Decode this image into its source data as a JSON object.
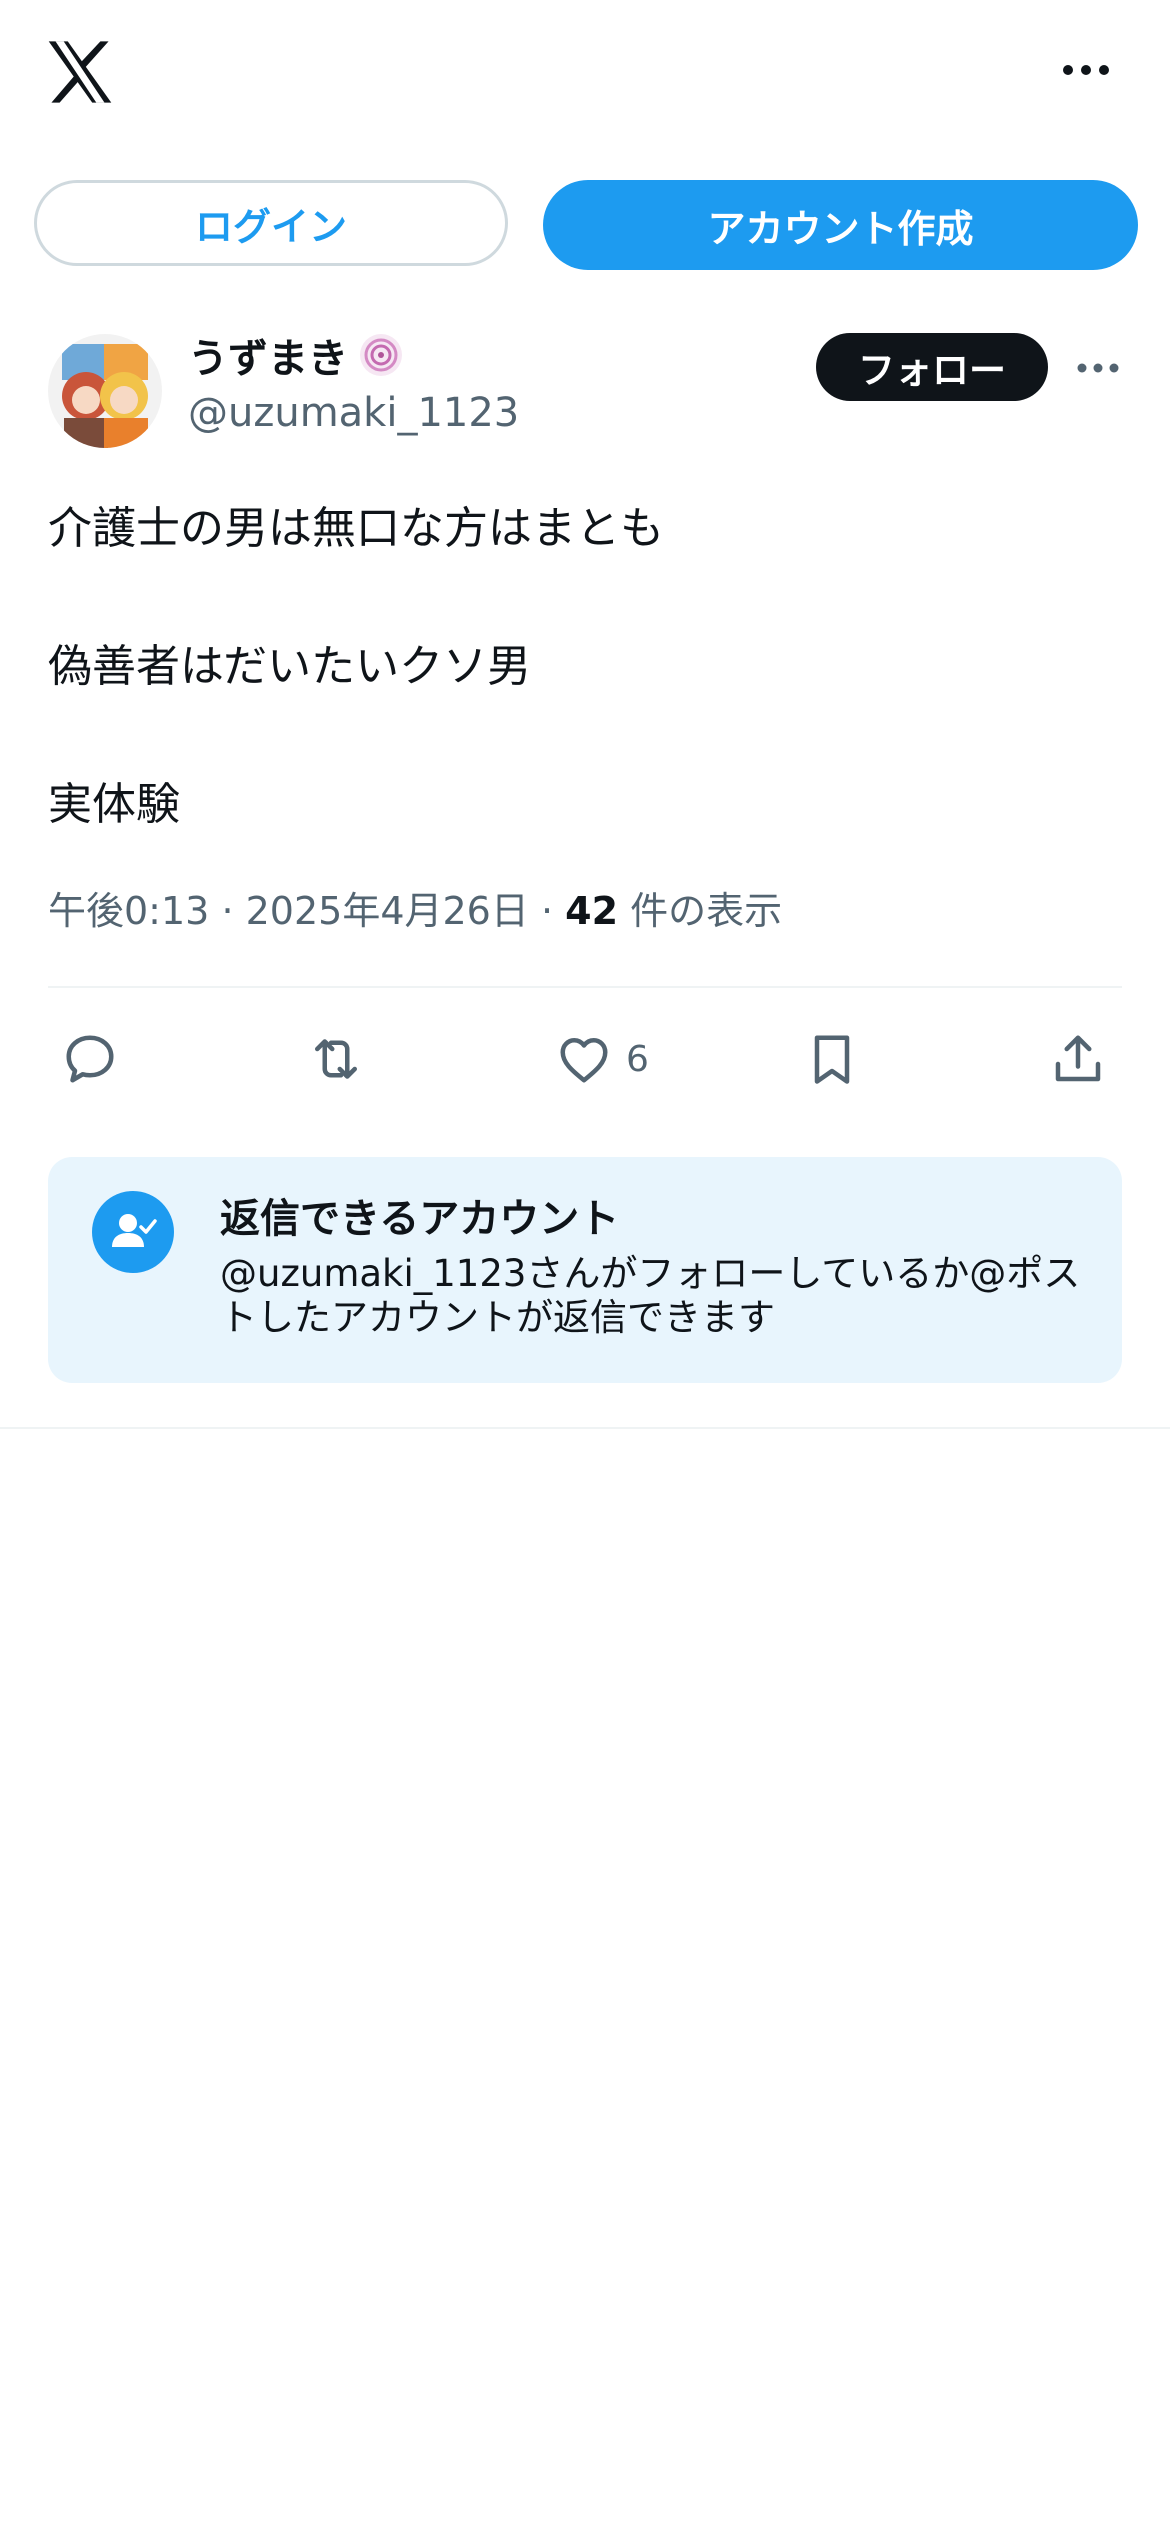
{
  "header": {
    "logo": "x-logo-icon",
    "more": "more-icon"
  },
  "auth": {
    "login_label": "ログイン",
    "signup_label": "アカウント作成"
  },
  "author": {
    "display_name": "うずまき",
    "handle": "@uzumaki_1123",
    "follow_label": "フォロー"
  },
  "tweet": {
    "lines": [
      "介護士の男は無口な方はまとも",
      "偽善者はだいたいクソ男",
      "実体験"
    ]
  },
  "meta": {
    "time": "午後0:13",
    "sep": "·",
    "date": "2025年4月26日",
    "views_count": "42",
    "views_label": "件の表示"
  },
  "actions": {
    "reply": "reply-icon",
    "retweet": "retweet-icon",
    "like": "like-icon",
    "like_count": "6",
    "bookmark": "bookmark-icon",
    "share": "share-icon"
  },
  "reply_card": {
    "title": "返信できるアカウント",
    "description": "@uzumaki_1123さんがフォローしているか@ポストしたアカウントが返信できます"
  },
  "colors": {
    "accent": "#1d9bf0",
    "text": "#0f1419",
    "secondary": "#536471",
    "card_bg": "#e8f5fd"
  }
}
